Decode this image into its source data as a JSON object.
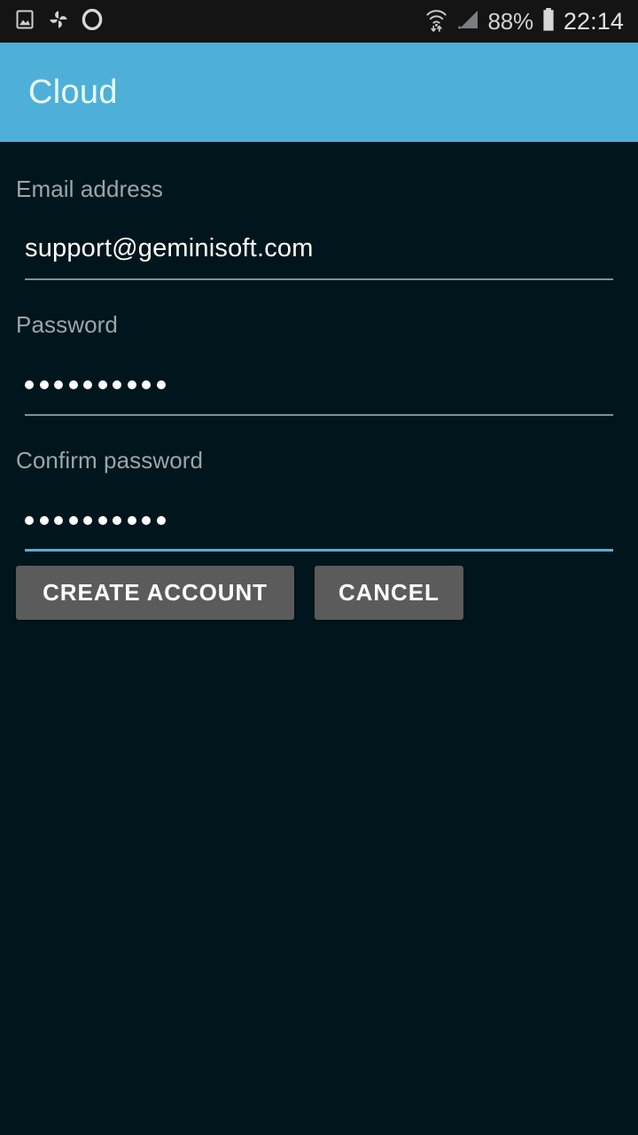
{
  "status_bar": {
    "left_icons": [
      "gallery-icon",
      "pinwheel-photos-icon",
      "opera-browser-icon"
    ],
    "right_icons": [
      "wifi-transfer-icon",
      "cell-signal-icon",
      "battery-icon"
    ],
    "battery_percent": "88%",
    "clock": "22:14",
    "background_color": "#141414",
    "text_color": "#d2d2d2"
  },
  "app_bar": {
    "title": "Cloud",
    "background_color": "#4eb0d8",
    "title_color": "#eafaff"
  },
  "form": {
    "fields": [
      {
        "label": "Email address",
        "value": "support@geminisoft.com",
        "placeholder": "Email address",
        "type": "email",
        "masked": false,
        "focused": false,
        "underline_color": "#7f9097"
      },
      {
        "label": "Password",
        "value": "••••••••••",
        "placeholder": "Password",
        "type": "password",
        "masked": true,
        "mask_dot_count": 10,
        "focused": false,
        "underline_color": "#7f9097"
      },
      {
        "label": "Confirm password",
        "value": "••••••••••",
        "placeholder": "Confirm password",
        "type": "password",
        "masked": true,
        "mask_dot_count": 10,
        "focused": true,
        "underline_color": "#5fa9cf"
      }
    ],
    "label_color": "#9aa6ab",
    "value_color": "#fdfdfd"
  },
  "buttons": {
    "create_account": "CREATE ACCOUNT",
    "cancel": "CANCEL",
    "background_color": "#5b5b5b",
    "text_color": "#ffffff"
  },
  "page": {
    "background_color": "#01151c"
  }
}
